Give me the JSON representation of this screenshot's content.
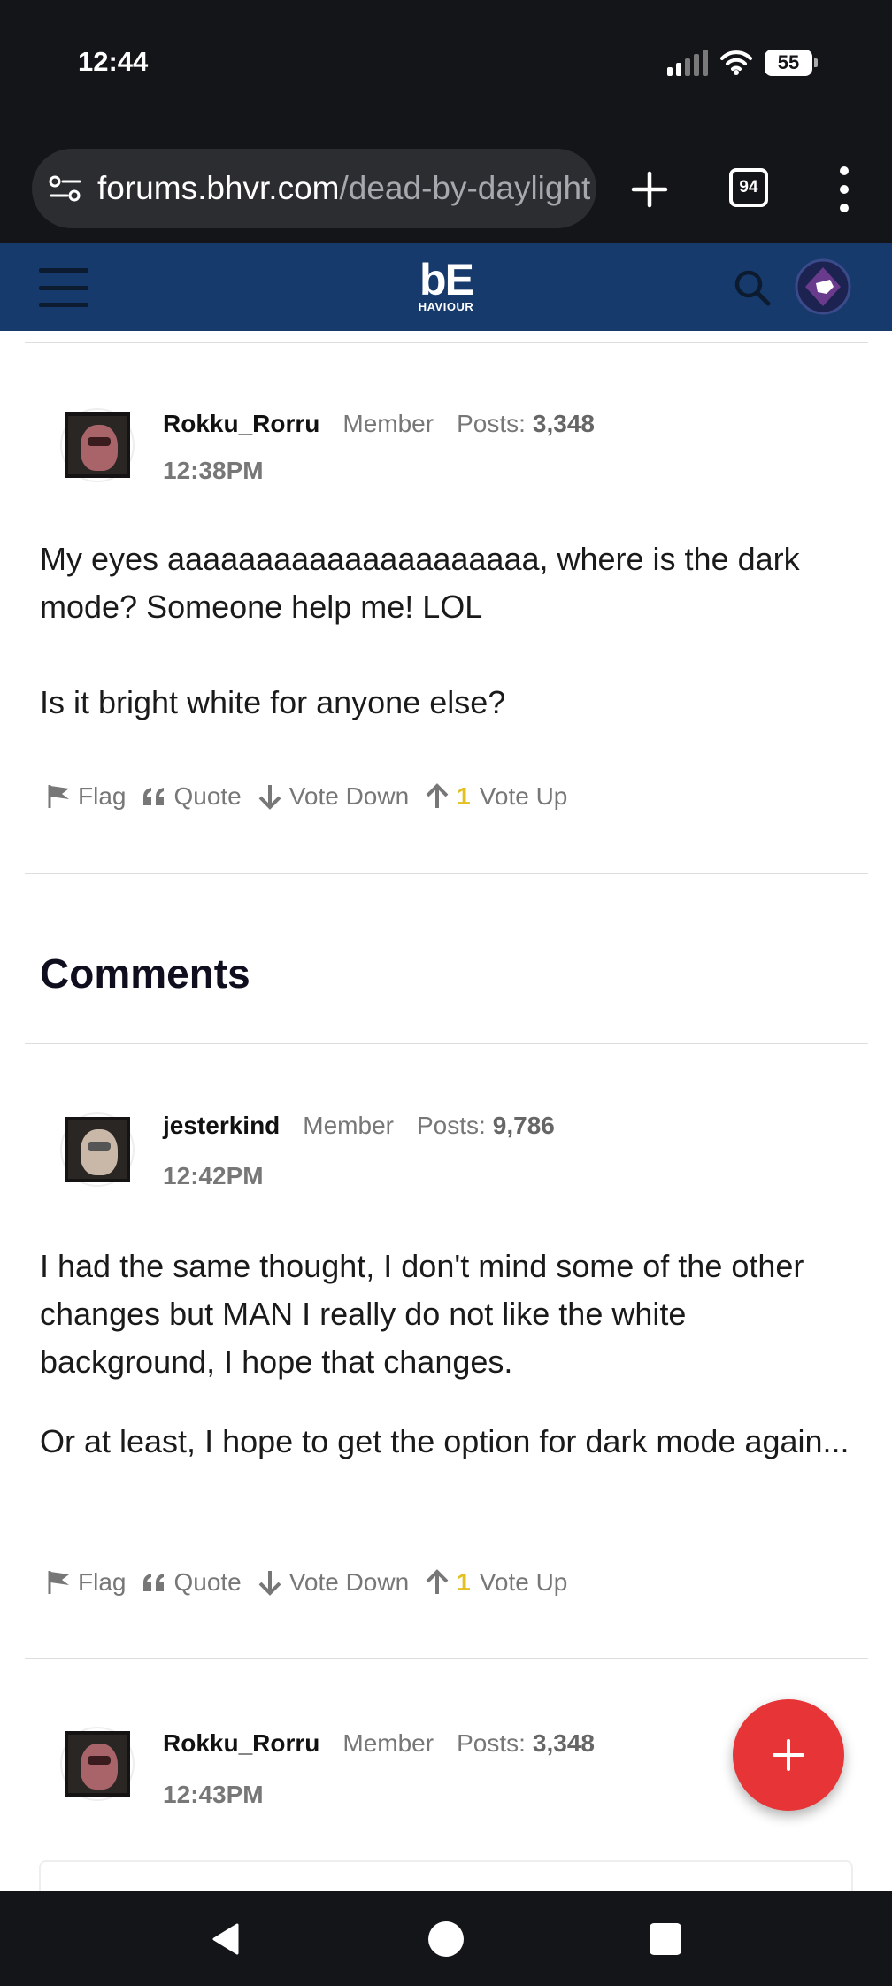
{
  "status_bar": {
    "time": "12:44",
    "battery": "55"
  },
  "browser": {
    "url_domain": "forums.bhvr.com",
    "url_path": "/dead-by-daylight",
    "tab_count": "94"
  },
  "site_header": {
    "logo_main": "bE",
    "logo_sub": "HAVIOUR"
  },
  "original_post": {
    "username": "Rokku_Rorru",
    "role": "Member",
    "posts_label": "Posts:",
    "posts_count": "3,348",
    "time": "12:38PM",
    "paragraphs": [
      "My eyes aaaaaaaaaaaaaaaaaaaaa, where is the dark mode? Someone help me! LOL",
      "Is it bright white for anyone else?"
    ],
    "actions": {
      "flag": "Flag",
      "quote": "Quote",
      "vote_down": "Vote Down",
      "vote_up_count": "1",
      "vote_up": "Vote Up"
    }
  },
  "comments_heading": "Comments",
  "comments": [
    {
      "username": "jesterkind",
      "role": "Member",
      "posts_label": "Posts:",
      "posts_count": "9,786",
      "time": "12:42PM",
      "paragraphs": [
        "I had the same thought, I don't mind some of the other changes but MAN I really do not like the white background, I hope that changes.",
        "Or at least, I hope to get the option for dark mode again..."
      ],
      "actions": {
        "flag": "Flag",
        "quote": "Quote",
        "vote_down": "Vote Down",
        "vote_up_count": "1",
        "vote_up": "Vote Up"
      }
    },
    {
      "username": "Rokku_Rorru",
      "role": "Member",
      "posts_label": "Posts:",
      "posts_count": "3,348",
      "time": "12:43PM"
    }
  ],
  "colors": {
    "header_blue": "#163a6b",
    "fab_red": "#e73436",
    "vote_count_yellow": "#e3c01f"
  }
}
